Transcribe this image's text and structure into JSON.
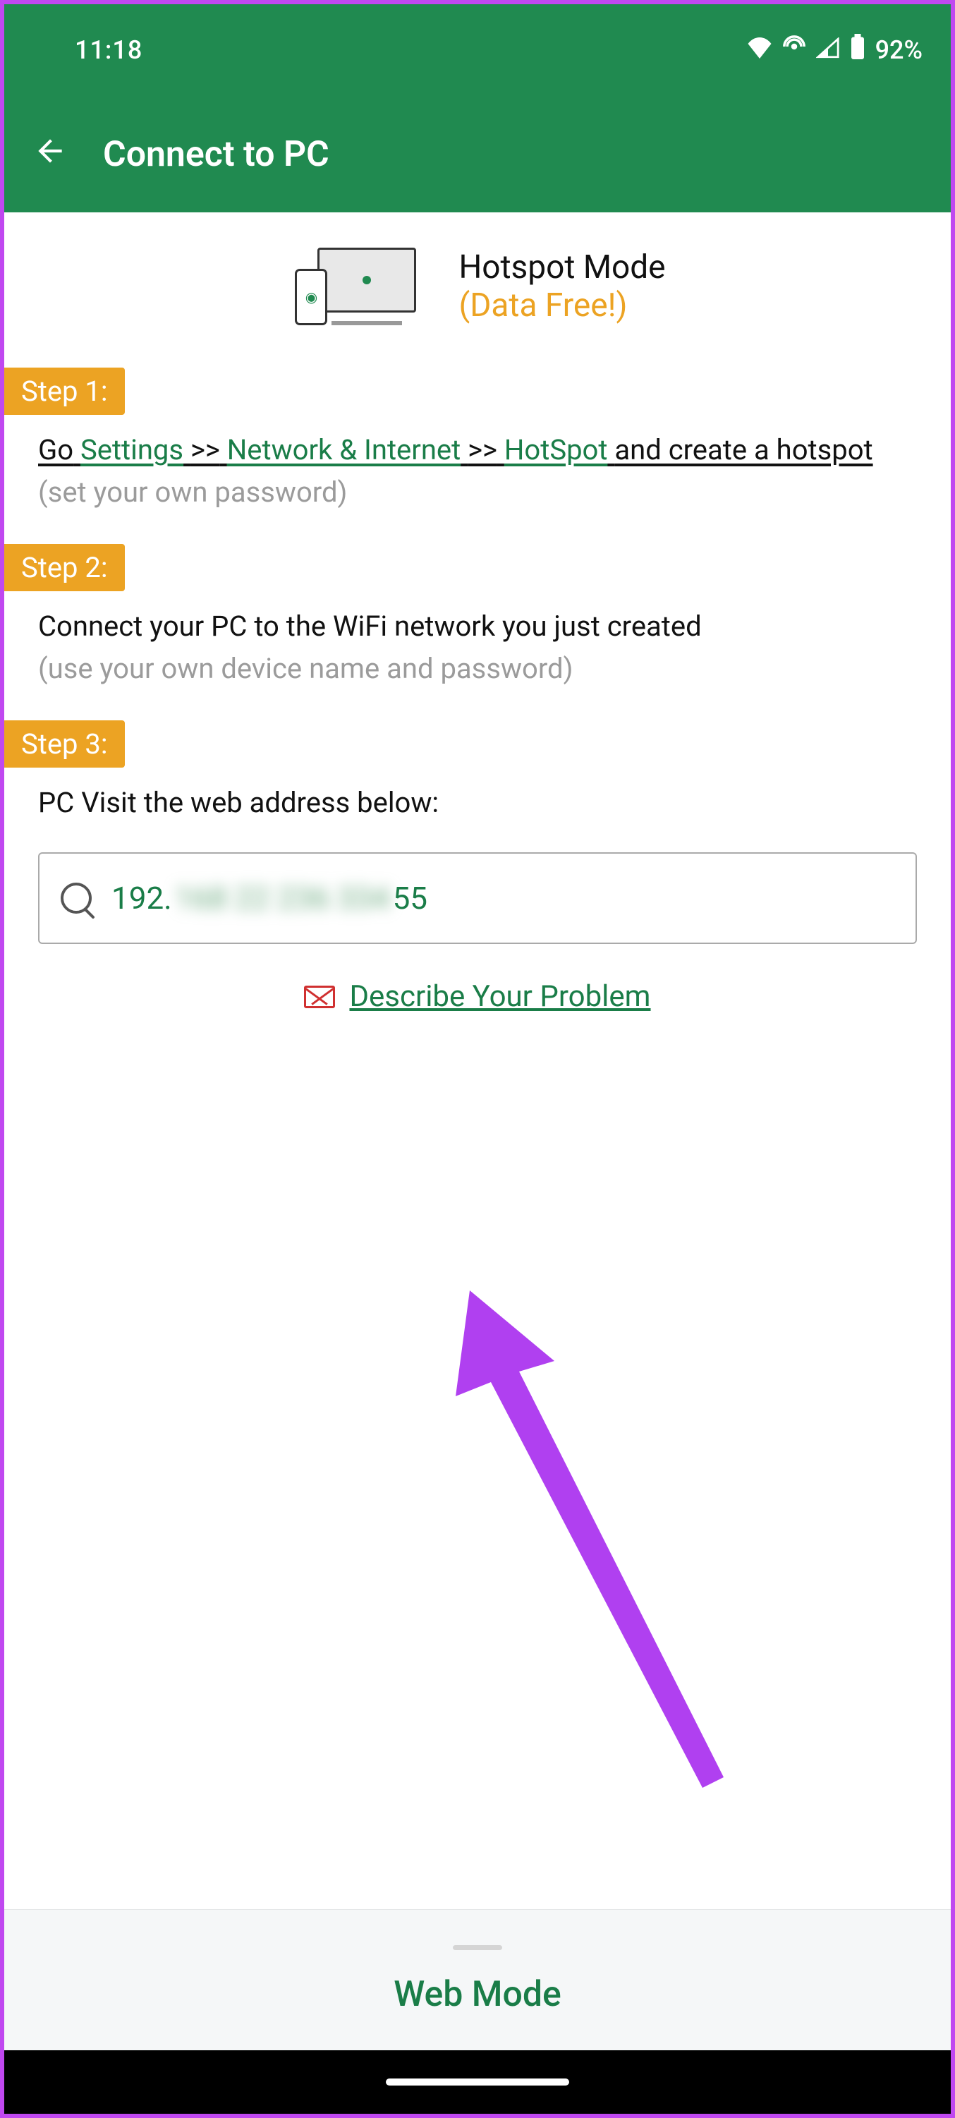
{
  "status": {
    "time": "11:18",
    "battery": "92%"
  },
  "appbar": {
    "title": "Connect to PC"
  },
  "hotspot": {
    "title": "Hotspot Mode",
    "subtitle": "(Data Free!)"
  },
  "steps": {
    "s1": {
      "label": "Step 1:",
      "go": "Go",
      "settings": "Settings",
      "sep": ">>",
      "network": "Network & Internet",
      "hotspot": "HotSpot",
      "tail": "and create a hotspot",
      "hint": "(set your own password)"
    },
    "s2": {
      "label": "Step 2:",
      "body": "Connect your PC to the WiFi network you just created",
      "hint": "(use your own device name and password)"
    },
    "s3": {
      "label": "Step 3:",
      "body": "PC Visit the web address below:"
    }
  },
  "address": {
    "prefix": "192.",
    "blurred": "168 22 236 334",
    "suffix": "55"
  },
  "describe": {
    "label": "Describe Your Problem"
  },
  "bottom": {
    "label": "Web Mode"
  }
}
